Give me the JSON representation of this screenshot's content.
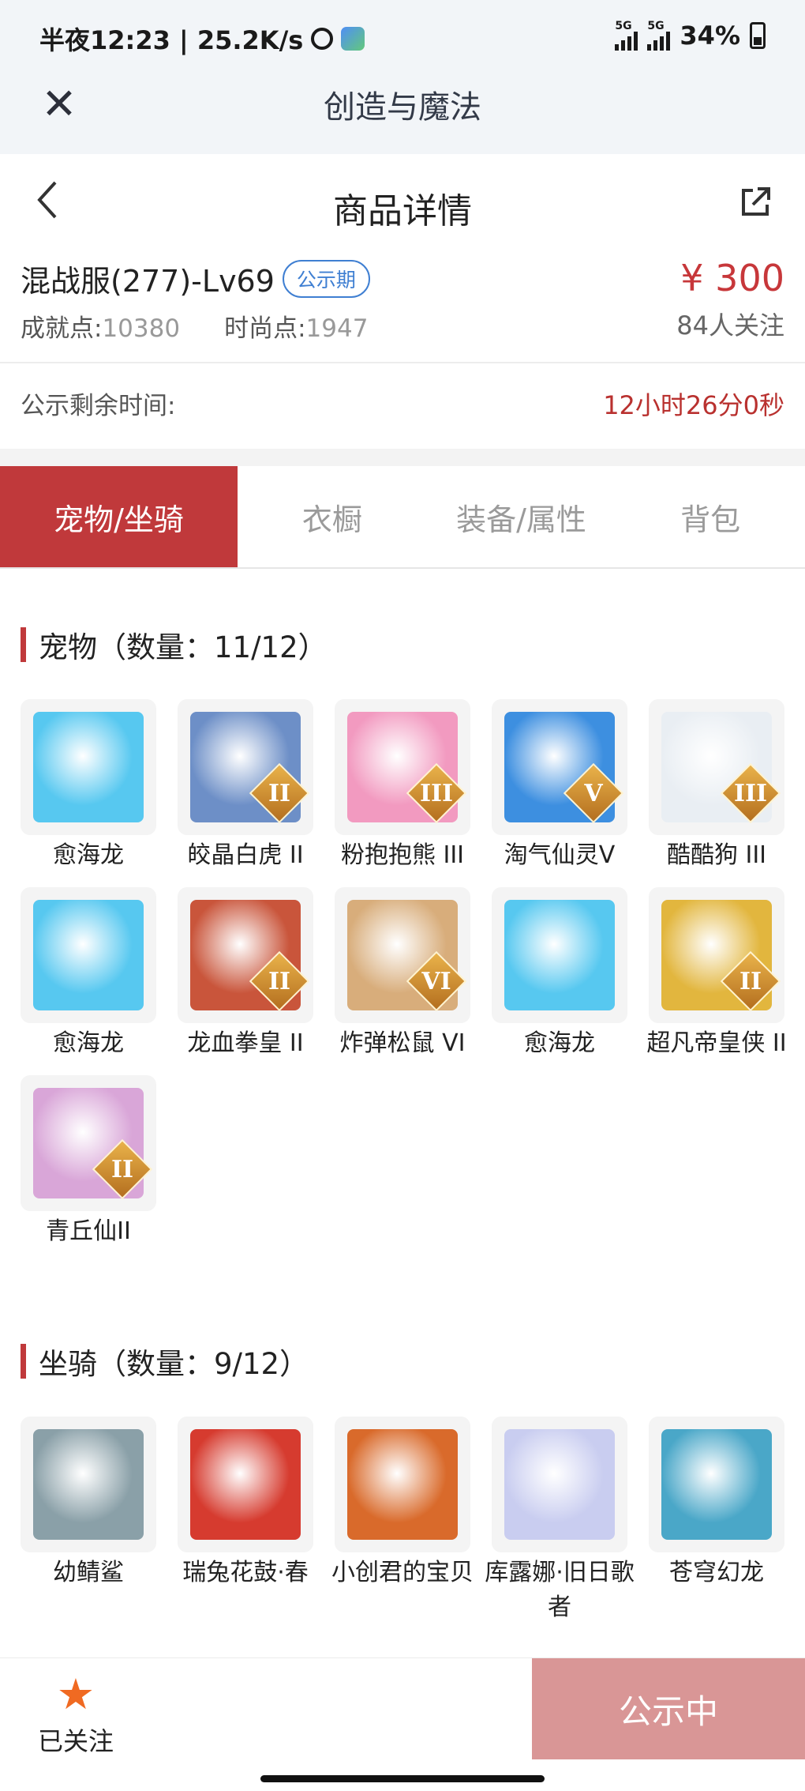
{
  "status_bar": {
    "time_speed": "半夜12:23 | 25.2K/s",
    "sim1": "5G",
    "sim2": "5G",
    "battery": "34%"
  },
  "app_bar": {
    "title": "创造与魔法",
    "close_icon": "close-icon"
  },
  "page_header": {
    "title": "商品详情",
    "back_icon": "chevron-left-icon",
    "share_icon": "share-external-icon"
  },
  "product": {
    "name": "混战服(277)-Lv69",
    "badge": "公示期",
    "achievement_label": "成就点:",
    "achievement_value": "10380",
    "fashion_label": "时尚点:",
    "fashion_value": "1947",
    "price": "¥ 300",
    "followers": "84人关注"
  },
  "countdown": {
    "label": "公示剩余时间:",
    "value": "12小时26分0秒"
  },
  "tabs": [
    {
      "label": "宠物/坐骑",
      "active": true
    },
    {
      "label": "衣橱",
      "active": false
    },
    {
      "label": "装备/属性",
      "active": false
    },
    {
      "label": "背包",
      "active": false
    }
  ],
  "pets": {
    "title": "宠物（数量：11/12）",
    "items": [
      {
        "name": "愈海龙",
        "tier": "",
        "color": "#57c8f0"
      },
      {
        "name": "皎晶白虎 II",
        "tier": "II",
        "color": "#6d8fc7"
      },
      {
        "name": "粉抱抱熊 III",
        "tier": "III",
        "color": "#f29ac0"
      },
      {
        "name": "淘气仙灵V",
        "tier": "V",
        "color": "#3d8fe0"
      },
      {
        "name": "酷酷狗 III",
        "tier": "III",
        "color": "#e9eef3"
      },
      {
        "name": "愈海龙",
        "tier": "",
        "color": "#57c8f0"
      },
      {
        "name": "龙血拳皇 II",
        "tier": "II",
        "color": "#c9553b"
      },
      {
        "name": "炸弹松鼠 VI",
        "tier": "VI",
        "color": "#d8ad7b"
      },
      {
        "name": "愈海龙",
        "tier": "",
        "color": "#57c8f0"
      },
      {
        "name": "超凡帝皇侠 II",
        "tier": "II",
        "color": "#e2b63e"
      },
      {
        "name": "青丘仙II",
        "tier": "II",
        "color": "#d9a6d8"
      }
    ]
  },
  "mounts": {
    "title": "坐骑（数量：9/12）",
    "items": [
      {
        "name": "幼鲭鲨",
        "tier": "",
        "color": "#8aa0a8"
      },
      {
        "name": "瑞兔花鼓·春",
        "tier": "",
        "color": "#d63b2f"
      },
      {
        "name": "小创君的宝贝",
        "tier": "",
        "color": "#d96a2b"
      },
      {
        "name": "库露娜·旧日歌者",
        "tier": "",
        "color": "#c9cdf0"
      },
      {
        "name": "苍穹幻龙",
        "tier": "",
        "color": "#4aa7c8"
      }
    ]
  },
  "bottom_bar": {
    "follow_label": "已关注",
    "action_label": "公示中"
  }
}
